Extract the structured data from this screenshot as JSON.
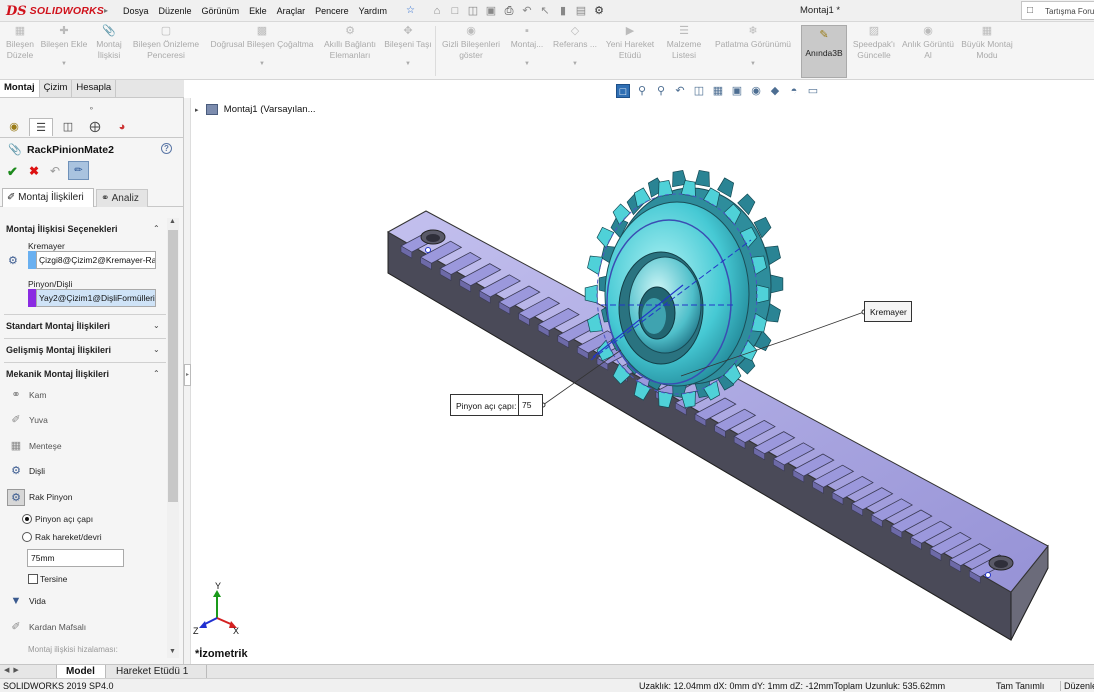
{
  "app": {
    "logo_text": "SOLIDWORKS",
    "document_title": "Montaj1 *",
    "forum_search": "Tartışma Forumu",
    "menus": [
      "Dosya",
      "Düzenle",
      "Görünüm",
      "Ekle",
      "Araçlar",
      "Pencere",
      "Yardım"
    ]
  },
  "command_manager": {
    "buttons": [
      {
        "label": "Bileşen Düzele",
        "icon": "edit-component-icon"
      },
      {
        "label": "Bileşen Ekle",
        "icon": "insert-component-icon"
      },
      {
        "label": "Montaj İlişkisi",
        "icon": "mate-icon"
      },
      {
        "label": "Bileşen Önizleme Penceresi",
        "icon": "preview-window-icon"
      },
      {
        "label": "Doğrusal Bileşen Çoğaltma",
        "icon": "linear-pattern-icon"
      },
      {
        "label": "Akıllı Bağlantı Elemanları",
        "icon": "smart-fastener-icon"
      },
      {
        "label": "Bileşeni Taşı",
        "icon": "move-component-icon"
      },
      {
        "label": "Gizli Bileşenleri göster",
        "icon": "show-hidden-icon"
      },
      {
        "label": "Montaj...",
        "icon": "assembly-feature-icon"
      },
      {
        "label": "Referans ...",
        "icon": "reference-geometry-icon"
      },
      {
        "label": "Yeni Hareket Etüdü",
        "icon": "motion-study-icon"
      },
      {
        "label": "Malzeme Listesi",
        "icon": "bom-icon"
      },
      {
        "label": "Patlatma Görünümü",
        "icon": "exploded-view-icon"
      },
      {
        "label": "Anında3B",
        "icon": "instant3d-icon"
      },
      {
        "label": "Speedpak'ı Güncelle",
        "icon": "speedpak-icon"
      },
      {
        "label": "Anlık Görüntü Al",
        "icon": "snapshot-icon"
      },
      {
        "label": "Büyük Montaj Modu",
        "icon": "large-assembly-icon"
      }
    ]
  },
  "tabs": [
    "Montaj",
    "Çizim",
    "Hesapla"
  ],
  "property_manager": {
    "title": "RackPinionMate2",
    "subtab_mates": "Montaj İlişkileri",
    "subtab_analysis": "Analiz",
    "mate_selections": {
      "header": "Montaj İlişkisi Seçenekleri",
      "rack_label": "Kremayer",
      "rack_value": "Çizgi8@Çizim2@Kremayer-Ra",
      "rack_color": "#6ab0f0",
      "pinion_label": "Pinyon/Dişli",
      "pinion_value": "Yay2@Çizim1@DişliFormülleri",
      "pinion_color": "#8a2be2"
    },
    "standard_mates": "Standart Montaj İlişkileri",
    "advanced_mates": "Gelişmiş Montaj İlişkileri",
    "mechanical_mates": "Mekanik Montaj İlişkileri",
    "mech_items": [
      {
        "label": "Kam",
        "icon": "cam-icon"
      },
      {
        "label": "Yuva",
        "icon": "slot-icon"
      },
      {
        "label": "Menteşe",
        "icon": "hinge-icon"
      },
      {
        "label": "Dişli",
        "icon": "gear-icon"
      },
      {
        "label": "Rak Pinyon",
        "icon": "rack-pinion-icon"
      }
    ],
    "radio_pitch": "Pinyon açı çapı",
    "radio_travel": "Rak hareket/devri",
    "pitch_value": "75mm",
    "reverse_label": "Tersine",
    "screw_label": "Vida",
    "universal_label": "Kardan Mafsalı",
    "alignment_label": "Montaj ilişkisi hizalaması:"
  },
  "graphics": {
    "tree_flyout": "Montaj1  (Varsayılan...",
    "callout_rack": "Kremayer",
    "callout_pinion_label": "Pinyon açı çapı:",
    "callout_pinion_value": "75",
    "view_label": "*İzometrik",
    "colors": {
      "rack": "#9b98dc",
      "gear": "#4fd1d8"
    }
  },
  "bottom_tabs": [
    "Model",
    "Hareket Etüdü 1"
  ],
  "status": {
    "version": "SOLIDWORKS 2019 SP4.0",
    "measure": "Uzaklık: 12.04mm   dX: 0mm  dY: 1mm  dZ: -12mmToplam Uzunluk: 535.62mm",
    "definition": "Tam Tanımlı",
    "editing": "Düzenleme: Montaj"
  }
}
